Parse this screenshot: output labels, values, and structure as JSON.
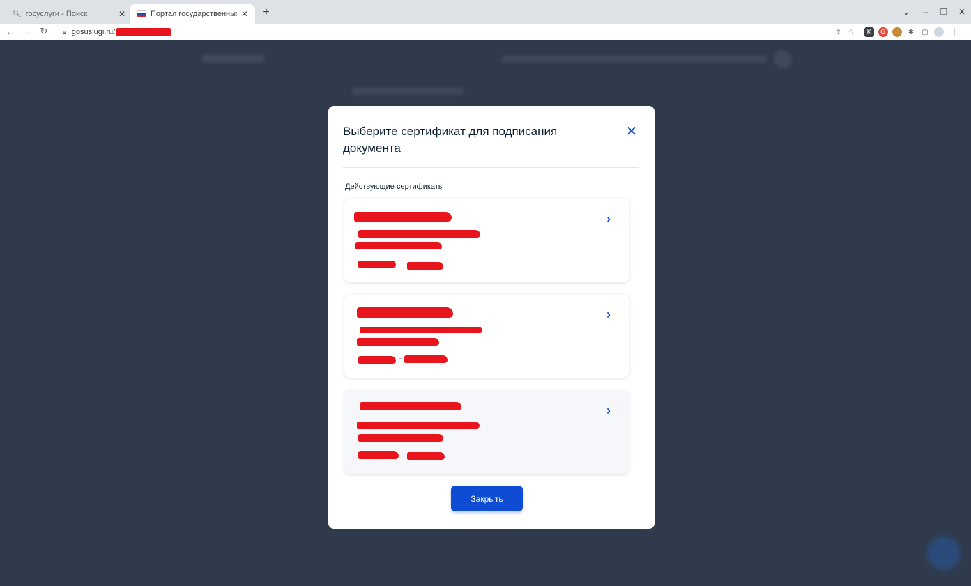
{
  "browser": {
    "tabs": [
      {
        "title": "госуслуги - Поиск",
        "active": false
      },
      {
        "title": "Портал государственных услуг",
        "active": true
      }
    ],
    "url_visible": "gosuslugi.ru/"
  },
  "modal": {
    "title": "Выберите сертификат для подписания документа",
    "section_label": "Действующие сертификаты",
    "certificates": [
      {
        "chevron": "›"
      },
      {
        "chevron": "›"
      },
      {
        "chevron": "›"
      }
    ],
    "close_button_label": "Закрыть"
  },
  "colors": {
    "accent": "#0d4cd3",
    "overlay_background": "#2f3b4c",
    "redaction": "#e8161c"
  },
  "icons": {
    "close": "close-icon",
    "chevron": "chevron-right-icon"
  }
}
